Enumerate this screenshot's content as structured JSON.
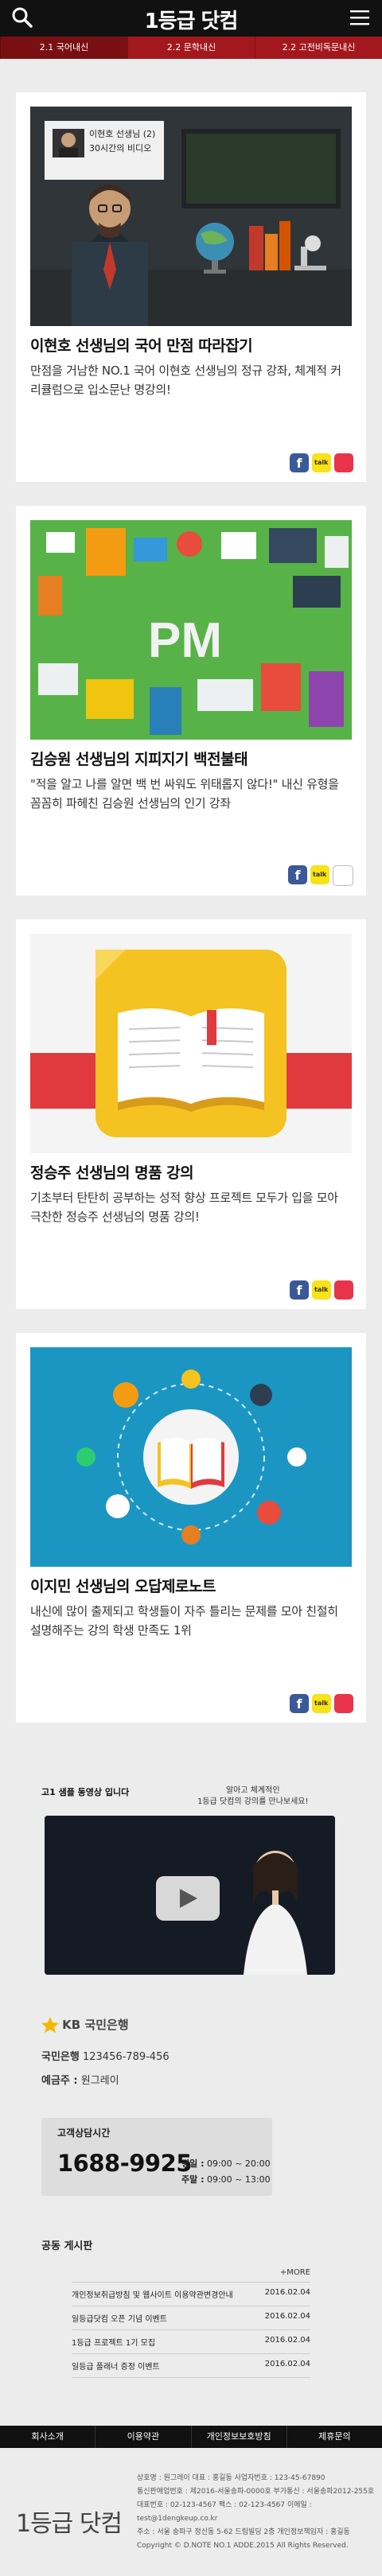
{
  "header": {
    "logo": "1등급 닷컴"
  },
  "categories": [
    "2.1 국어내신",
    "2.2 문학내신",
    "2.2 고전비독문내신"
  ],
  "cards": [
    {
      "title": "이현호 선생님의 국어 만점 따라잡기",
      "desc": "만점을 거남한 NO.1 국어 이현호 선생님의 정규 강좌, 체계적 커리큘럼으로 입소문난 명강의!",
      "thumb_label": "이현호 선생님 (2) 30시간의 비디오"
    },
    {
      "title": "김승원 선생님의 지피지기 백전불태",
      "desc": "\"적을 알고 나를 알면 백 번 싸워도 위태롭지 않다!\" 내신 유형을 꼼꼼히 파헤친 김승원 선생님의 인기 강좌",
      "thumb_label": "PM"
    },
    {
      "title": "정승주 선생님의 명품 강의",
      "desc": "기초부터 탄탄히 공부하는 성적 향상 프로젝트 모두가 입을 모아 극찬한 정승주 선생님의 명품 강의!"
    },
    {
      "title": "이지민 선생님의 오답제로노트",
      "desc": "내신에 많이 출제되고 학생들이 자주 틀리는 문제를 모아 친절히 설명해주는 강의 학생 만족도 1위"
    }
  ],
  "share": {
    "fb": "f"
  },
  "video": {
    "title": "고1 샘플 동영상 입니다",
    "sub_line1": "알아고 체계적인",
    "sub_line2": "1등급 닷컴의 강의를 만나보세요!"
  },
  "bank": {
    "name": "KB 국민은행",
    "account_label": "국민은행",
    "account": "123456-789-456",
    "holder_label": "예금주 :",
    "holder": "원그레이"
  },
  "cs": {
    "title": "고객상담시간",
    "phone": "1688-9925",
    "weekday_label": "평일 :",
    "weekday": "09:00 ~ 20:00",
    "sat_label": "주말 :",
    "sat": "09:00 ~ 13:00"
  },
  "board": {
    "title": "공동 게시판",
    "more": "+MORE",
    "rows": [
      {
        "text": "개인정보취급방침 및 웹사이트 이용약관변경안내",
        "date": "2016.02.04"
      },
      {
        "text": "일등급닷컴 오픈 기념 이벤트",
        "date": "2016.02.04"
      },
      {
        "text": "1등급 프로젝트 1기 모집",
        "date": "2016.02.04"
      },
      {
        "text": "일등급 플래너 증정 이벤트",
        "date": "2016.02.04"
      }
    ]
  },
  "footnav": [
    "회사소개",
    "이용약관",
    "개인정보보호방침",
    "제휴문의"
  ],
  "footer": {
    "logo": "1등급 닷컴",
    "line1": "상호명 : 원그레이  대표 : 홍길동  사업자번호 : 123-45-67890",
    "line2": "통신판매업번호 : 제2016-서울송파-0000호  부가통신 : 서울송파2012-255호",
    "line3": "대표번호 : 02-123-4567  팩스 : 02-123-4567  이메일 : test@1dengkeup.co.kr",
    "line4": "주소 : 서울 송파구 정신동 5-62 드림빌딩 2층  개인정보책임자 : 홍길동",
    "line5": "Copyright © D.NOTE NO.1 ADDE.2015 All Rights Reserved."
  }
}
